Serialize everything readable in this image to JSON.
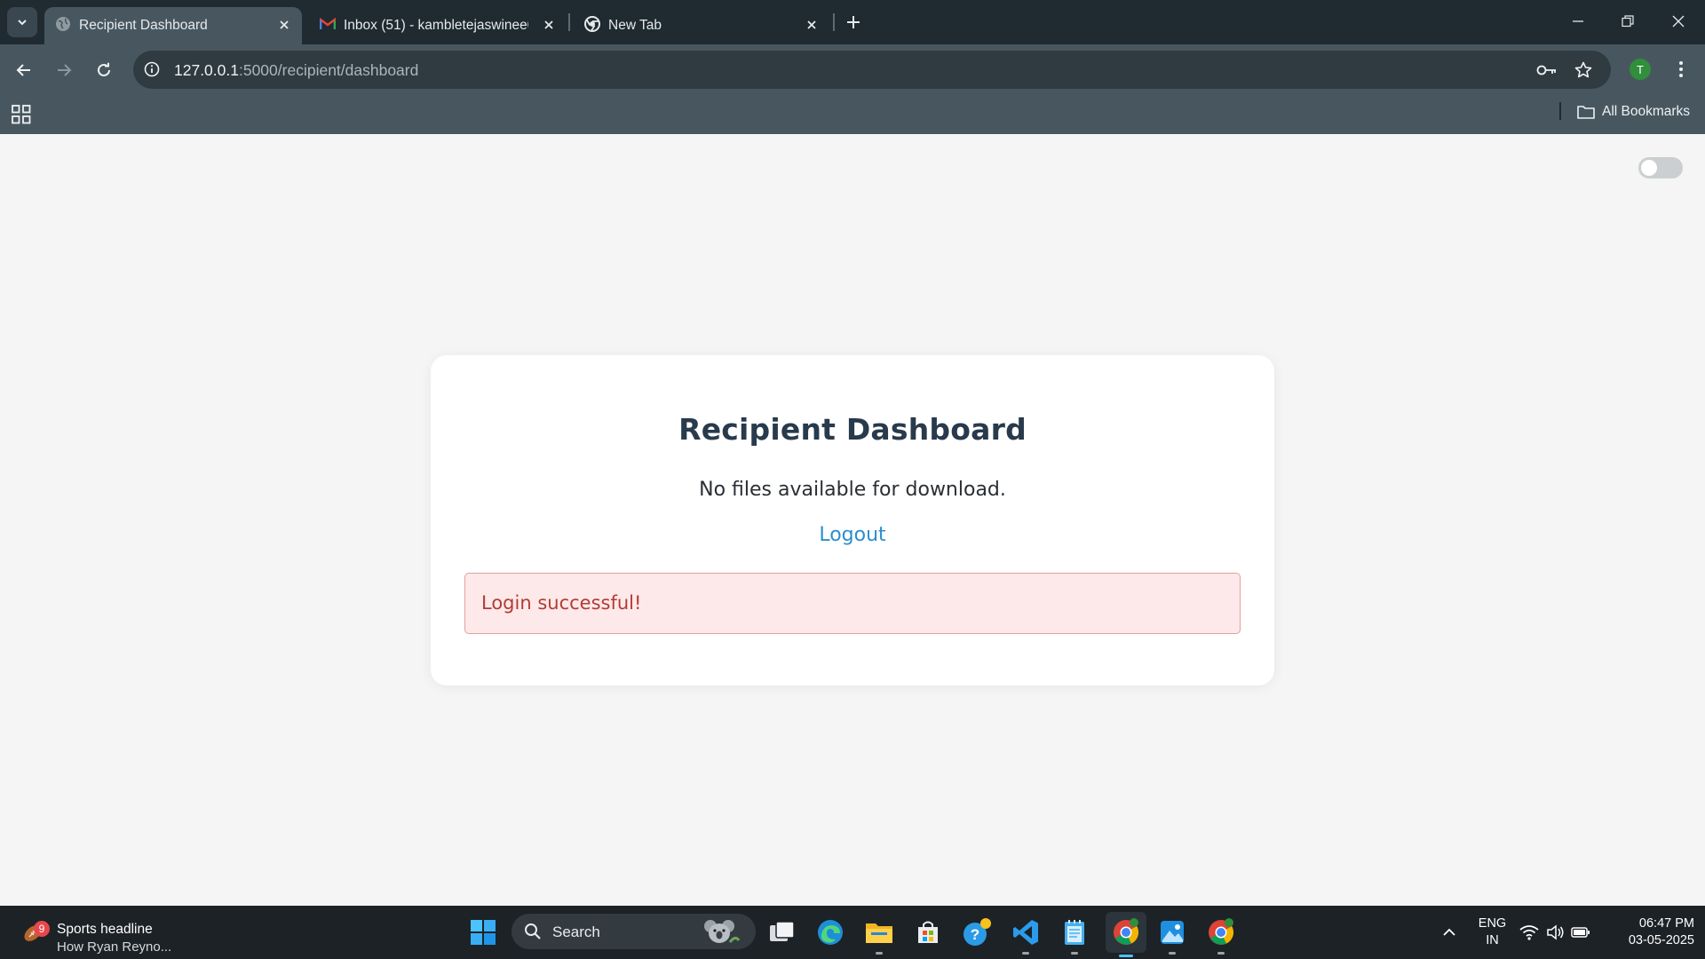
{
  "browser": {
    "tabs": [
      {
        "title": "Recipient Dashboard",
        "active": true,
        "favicon": "globe-icon"
      },
      {
        "title": "Inbox (51) - kambletejaswinee0",
        "active": false,
        "favicon": "gmail-icon"
      },
      {
        "title": "New Tab",
        "active": false,
        "favicon": "chrome-icon"
      }
    ],
    "url_host": "127.0.0.1",
    "url_path": ":5000/recipient/dashboard",
    "profile_initial": "T",
    "bookmarks_label": "All Bookmarks"
  },
  "page": {
    "heading": "Recipient Dashboard",
    "message": "No files available for download.",
    "logout_label": "Logout",
    "alert_text": "Login successful!",
    "theme_toggle_on": false
  },
  "taskbar": {
    "widget_badge": "9",
    "widget_title": "Sports headline",
    "widget_subtitle": "How Ryan Reyno...",
    "search_label": "Search",
    "language_line1": "ENG",
    "language_line2": "IN",
    "time": "06:47 PM",
    "date": "03-05-2025"
  },
  "colors": {
    "accent_link": "#2c8ed0",
    "alert_text": "#b33b35",
    "alert_bg": "#fde9e9",
    "heading": "#283a4c"
  }
}
